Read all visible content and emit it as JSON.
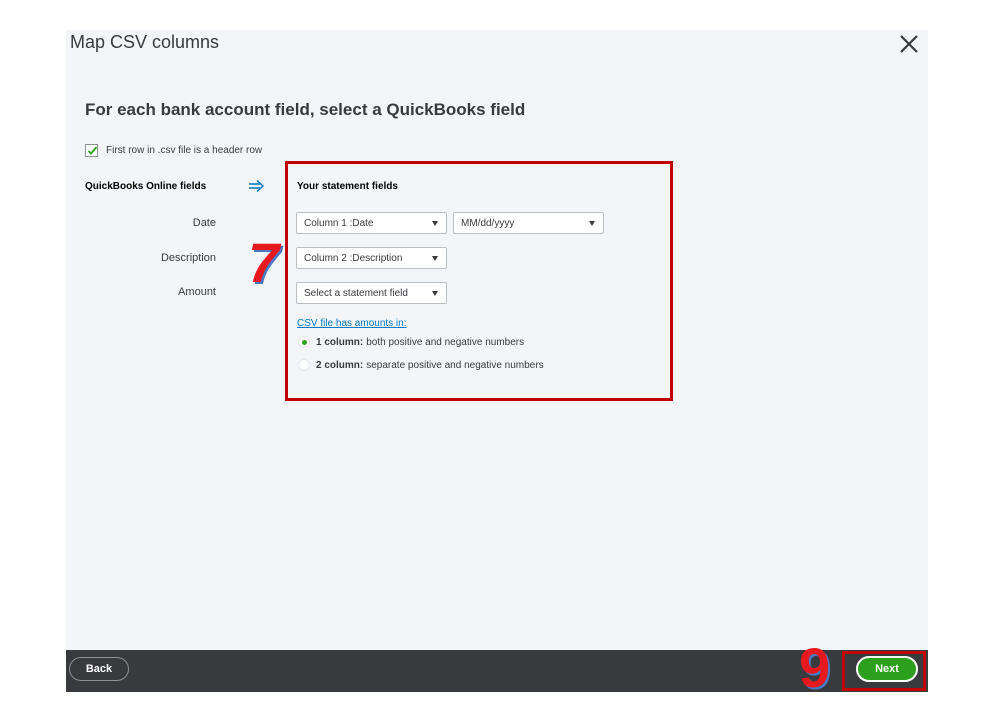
{
  "dialog": {
    "title": "Map CSV columns",
    "close_icon": "close-icon",
    "heading": "For each bank account field, select a QuickBooks field"
  },
  "header_row": {
    "label": "First row in .csv file is a header row",
    "checked": true
  },
  "qbo_fields": {
    "heading": "QuickBooks Online fields",
    "arrow_icon": "right-arrow-icon",
    "items": [
      "Date",
      "Description",
      "Amount"
    ]
  },
  "statement_fields": {
    "heading": "Your statement fields",
    "date_column": "Column 1 :Date",
    "date_format": "MM/dd/yyyy",
    "description_column": "Column 2 :Description",
    "amount_column": "Select a statement field",
    "csv_amounts_link": "CSV file has amounts in:",
    "options": [
      {
        "bold": "1 column:",
        "text": "both positive and negative numbers",
        "selected": true
      },
      {
        "bold": "2 column:",
        "text": "separate positive and negative numbers",
        "selected": false
      }
    ]
  },
  "annotations": {
    "step_seven": "7",
    "step_nine": "9",
    "color": "#c00000"
  },
  "footer": {
    "back_label": "Back",
    "next_label": "Next"
  },
  "colors": {
    "accent_green": "#2ca01c",
    "link_blue": "#0077c5",
    "footer_bg": "#393a3d",
    "dialog_bg": "#f4f5f8"
  }
}
